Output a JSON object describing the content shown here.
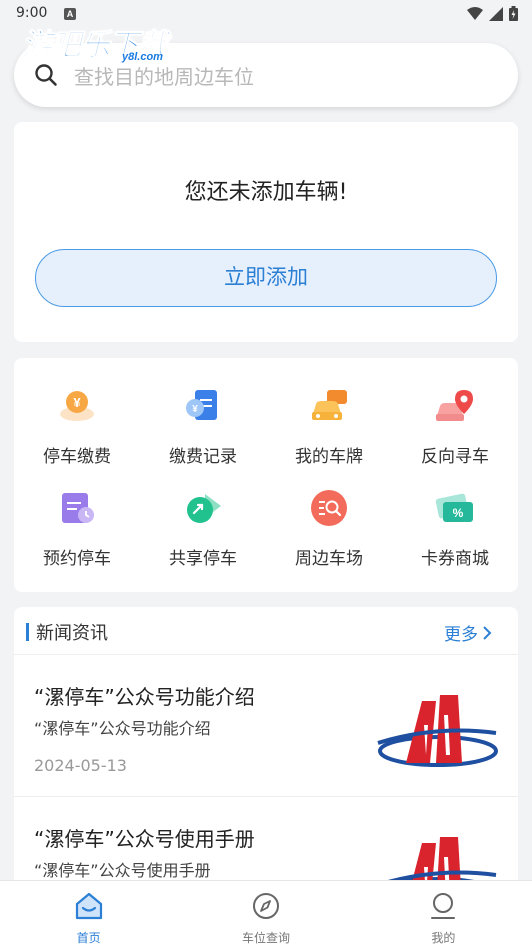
{
  "status": {
    "time": "9:00",
    "a_badge": "A"
  },
  "watermark": {
    "text": "游吧乐下载",
    "sub": "y8l.com"
  },
  "search": {
    "placeholder": "查找目的地周边车位"
  },
  "vehicle": {
    "title": "您还未添加车辆!",
    "add_label": "立即添加"
  },
  "services": [
    {
      "label": "停车缴费",
      "icon": "coin-hand-icon"
    },
    {
      "label": "缴费记录",
      "icon": "clipboard-coin-icon"
    },
    {
      "label": "我的车牌",
      "icon": "car-plate-icon"
    },
    {
      "label": "反向寻车",
      "icon": "car-location-icon"
    },
    {
      "label": "预约停车",
      "icon": "calendar-clock-icon"
    },
    {
      "label": "共享停车",
      "icon": "share-tag-icon"
    },
    {
      "label": "周边车场",
      "icon": "search-list-icon"
    },
    {
      "label": "卡券商城",
      "icon": "coupon-ticket-icon"
    }
  ],
  "news": {
    "title": "新闻资讯",
    "more": "更多",
    "items": [
      {
        "title": "“漯停车”公众号功能介绍",
        "desc": "“漯停车”公众号功能介绍",
        "date": "2024-05-13"
      },
      {
        "title": "“漯停车”公众号使用手册",
        "desc": "“漯停车”公众号使用手册",
        "date": ""
      }
    ]
  },
  "tabs": [
    {
      "label": "首页",
      "icon": "home-icon",
      "active": true
    },
    {
      "label": "车位查询",
      "icon": "compass-icon",
      "active": false
    },
    {
      "label": "我的",
      "icon": "user-icon",
      "active": false
    }
  ],
  "colors": {
    "accent": "#2b7fd4",
    "background": "#f2f3f5"
  }
}
